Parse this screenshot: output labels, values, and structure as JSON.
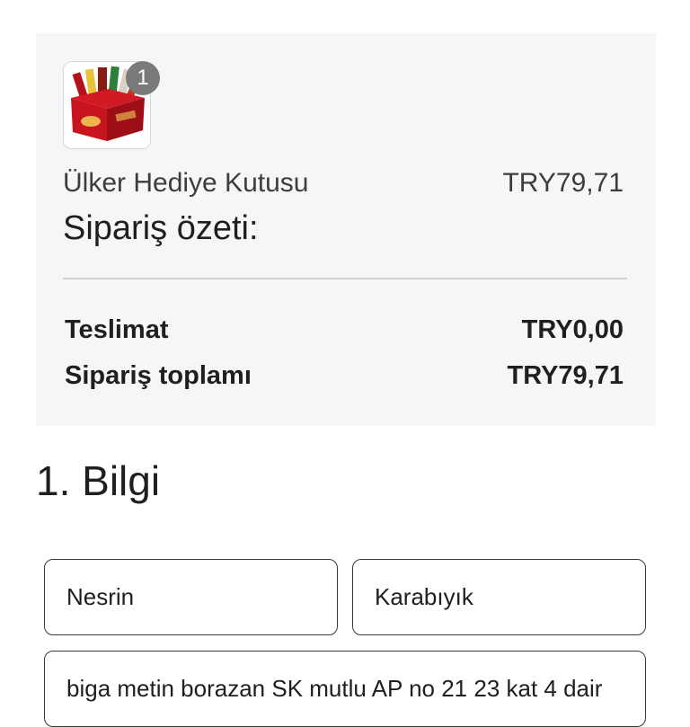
{
  "order_summary": {
    "product": {
      "image_icon": "gift-box-icon",
      "quantity": "1",
      "name": "Ülker Hediye Kutusu",
      "price": "TRY79,71"
    },
    "title": "Sipariş özeti:",
    "rows": [
      {
        "label": "Teslimat",
        "value": "TRY0,00"
      },
      {
        "label": "Sipariş toplamı",
        "value": "TRY79,71"
      }
    ]
  },
  "info_section": {
    "heading": "1. Bilgi",
    "first_name": "Nesrin",
    "last_name": "Karabıyık",
    "address": "biga metin borazan SK mutlu AP no 21 23 kat 4 dair"
  },
  "colors": {
    "card_background": "#f5f6f8",
    "badge": "#7a7a7a",
    "box_red": "#c8141e"
  }
}
